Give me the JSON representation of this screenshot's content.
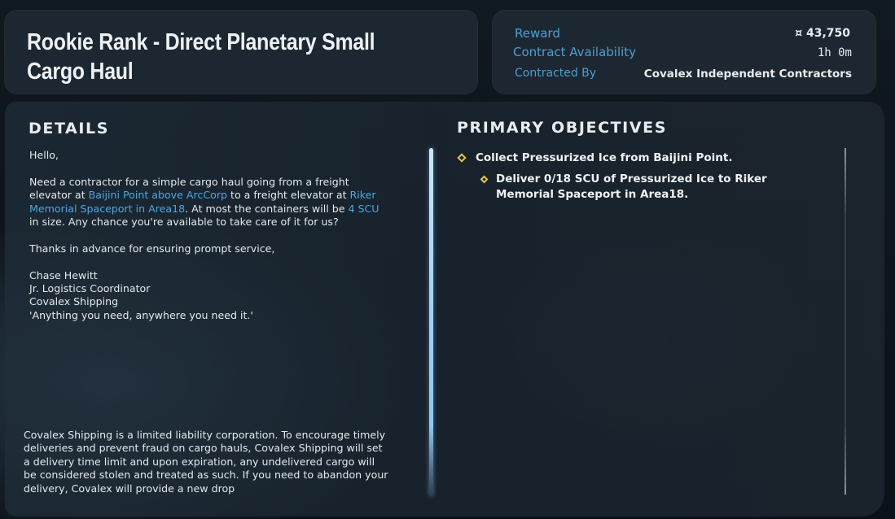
{
  "contract": {
    "title": "Rookie Rank - Direct Planetary Small Cargo Haul"
  },
  "info": {
    "reward_label": "Reward",
    "reward_value": "¤ 43,750",
    "availability_label": "Contract Availability",
    "availability_value": "1h 0m",
    "contracted_by_label": "Contracted By",
    "contracted_by_value": "Covalex Independent Contractors"
  },
  "details": {
    "heading": "DETAILS",
    "greeting": "Hello,",
    "body_1": "Need a contractor for a simple cargo haul going from a freight elevator at ",
    "origin": "Baijini Point above ArcCorp",
    "body_2": " to a freight elevator at ",
    "destination": "Riker Memorial Spaceport in Area18",
    "body_3": ". At most the containers will be ",
    "size": "4 SCU",
    "body_4": " in size. Any chance you're available to take care of it for us?",
    "thanks": "Thanks in advance for ensuring prompt service,",
    "sender_name": "Chase Hewitt",
    "sender_title": "Jr. Logistics Coordinator",
    "sender_company": "Covalex Shipping",
    "sender_motto": "'Anything you need, anywhere you need it.'",
    "footer": "Covalex Shipping is a limited liability corporation. To encourage timely deliveries and prevent fraud on cargo hauls, Covalex Shipping will set a delivery time limit and upon expiration, any undelivered cargo will be considered stolen and treated as such. If you need to abandon your delivery, Covalex will provide a new drop"
  },
  "objectives": {
    "heading": "PRIMARY OBJECTIVES",
    "items": [
      {
        "text": "Collect Pressurized Ice from Baijini Point."
      },
      {
        "text": "Deliver 0/18 SCU of Pressurized Ice to Riker Memorial Spaceport in Area18."
      }
    ]
  },
  "colors": {
    "accent": "#4ea6e0",
    "objective_marker": "#e8c24a"
  }
}
